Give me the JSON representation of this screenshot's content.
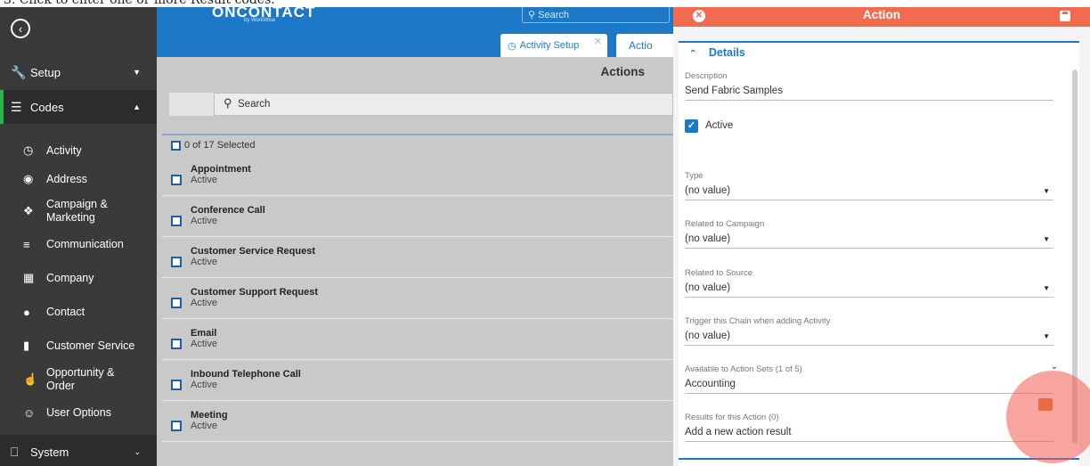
{
  "caption": "3. Click to enter one or more Result codes.",
  "sidebar": {
    "setup": "Setup",
    "codes": "Codes",
    "items": [
      {
        "label": "Activity",
        "icon": "clock-icon"
      },
      {
        "label": "Address",
        "icon": "map-pin-icon"
      },
      {
        "label": "Campaign & Marketing",
        "icon": "campaign-icon"
      },
      {
        "label": "Communication",
        "icon": "list-icon"
      },
      {
        "label": "Company",
        "icon": "building-icon"
      },
      {
        "label": "Contact",
        "icon": "person-icon"
      },
      {
        "label": "Customer Service",
        "icon": "chat-alert-icon"
      },
      {
        "label": "Opportunity & Order",
        "icon": "thumbs-up-icon"
      },
      {
        "label": "User Options",
        "icon": "user-outline-icon"
      }
    ],
    "system": "System"
  },
  "header": {
    "logo": "ONCONTACT",
    "logo_sub": "by WorkWise",
    "search_placeholder": "Search",
    "tab_activity": "Activity Setup",
    "tab_action": "Actio"
  },
  "main": {
    "title": "Actions",
    "search_placeholder": "Search",
    "selected": "0 of 17 Selected",
    "rows": [
      {
        "name": "Appointment",
        "status": "Active"
      },
      {
        "name": "Conference Call",
        "status": "Active"
      },
      {
        "name": "Customer Service Request",
        "status": "Active"
      },
      {
        "name": "Customer Support Request",
        "status": "Active"
      },
      {
        "name": "Email",
        "status": "Active"
      },
      {
        "name": "Inbound Telephone Call",
        "status": "Active"
      },
      {
        "name": "Meeting",
        "status": "Active"
      }
    ]
  },
  "panel": {
    "title": "Action",
    "section": "Details",
    "description_label": "Description",
    "description_value": "Send Fabric Samples",
    "active_label": "Active",
    "type_label": "Type",
    "type_value": "(no value)",
    "campaign_label": "Related to Campaign",
    "campaign_value": "(no value)",
    "source_label": "Related to Source",
    "source_value": "(no value)",
    "trigger_label": "Trigger this Chain when adding Activity",
    "trigger_value": "(no value)",
    "sets_label": "Available to Action Sets (1 of 5)",
    "sets_value": "Accounting",
    "results_label": "Results for this Action (0)",
    "results_value": "Add a new action result"
  },
  "colors": {
    "sidebar_bg": "#3a3a3a",
    "header_blue": "#1e78c8",
    "panel_header": "#f26a4f",
    "active_green": "#27b24a"
  }
}
